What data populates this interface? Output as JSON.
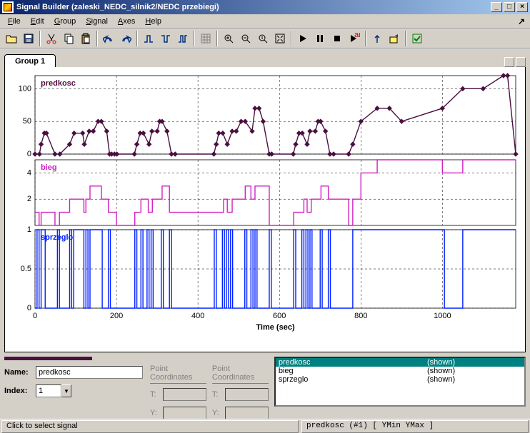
{
  "window": {
    "title": "Signal Builder (zaleski_NEDC_silnik2/NEDC przebiegi)"
  },
  "menu": {
    "file": "File",
    "edit": "Edit",
    "group": "Group",
    "signal": "Signal",
    "axes": "Axes",
    "help": "Help"
  },
  "tabs": {
    "group1": "Group 1"
  },
  "fields": {
    "name_label": "Name:",
    "name_value": "predkosc",
    "index_label": "Index:",
    "index_value": "1",
    "pc_header1": "Point Coordinates",
    "pc_header2": "Point Coordinates",
    "t_label": "T:",
    "y_label": "Y:"
  },
  "signals": {
    "header_name": "predkosc",
    "header_state": "(shown)",
    "rows": [
      {
        "name": "bieg",
        "state": "(shown)"
      },
      {
        "name": "sprzeglo",
        "state": "(shown)"
      }
    ],
    "colors": [
      "#4b0f3f",
      "#d020c0",
      "#0020ff"
    ]
  },
  "status": {
    "left": "Click to select signal",
    "right": "predkosc (#1)   [ YMin YMax ]"
  },
  "chart_data": [
    {
      "type": "line",
      "title": "predkosc",
      "xlabel": "Time (sec)",
      "xlim": [
        0,
        1180
      ],
      "ylim": [
        0,
        120
      ],
      "yticks": [
        0,
        50,
        100
      ],
      "color": "#4b0f3f",
      "markers": true,
      "x": [
        0,
        11,
        15,
        23,
        28,
        49,
        61,
        85,
        96,
        117,
        121,
        133,
        143,
        155,
        163,
        176,
        183,
        188,
        195,
        201,
        244,
        250,
        258,
        266,
        280,
        287,
        300,
        306,
        312,
        324,
        335,
        344,
        439,
        445,
        451,
        461,
        472,
        484,
        494,
        506,
        516,
        533,
        540,
        550,
        560,
        575,
        581,
        634,
        640,
        648,
        656,
        668,
        675,
        688,
        695,
        701,
        713,
        724,
        733,
        770,
        780,
        800,
        840,
        870,
        900,
        1000,
        1050,
        1100,
        1150,
        1160,
        1180
      ],
      "y": [
        0,
        0,
        15,
        32,
        32,
        0,
        0,
        15,
        32,
        32,
        15,
        35,
        35,
        50,
        50,
        35,
        0,
        0,
        0,
        0,
        0,
        15,
        32,
        32,
        15,
        35,
        35,
        50,
        50,
        35,
        0,
        0,
        0,
        15,
        32,
        32,
        15,
        35,
        35,
        50,
        50,
        35,
        70,
        70,
        50,
        0,
        0,
        0,
        15,
        32,
        32,
        15,
        35,
        35,
        50,
        50,
        35,
        0,
        0,
        0,
        15,
        50,
        70,
        70,
        50,
        70,
        100,
        100,
        120,
        120,
        0
      ]
    },
    {
      "type": "line",
      "title": "bieg",
      "xlim": [
        0,
        1180
      ],
      "ylim": [
        0,
        5
      ],
      "yticks": [
        2,
        4
      ],
      "color": "#d020c0",
      "step": true,
      "x": [
        0,
        10,
        15,
        28,
        49,
        60,
        85,
        120,
        125,
        135,
        163,
        180,
        200,
        245,
        260,
        278,
        288,
        312,
        330,
        440,
        463,
        472,
        484,
        516,
        530,
        540,
        575,
        635,
        660,
        668,
        678,
        702,
        720,
        770,
        780,
        800,
        840,
        1000,
        1050,
        1180
      ],
      "y": [
        1,
        0,
        1,
        1,
        0,
        1,
        2,
        1,
        2,
        3,
        2,
        1,
        0,
        1,
        2,
        1,
        2,
        3,
        1,
        1,
        2,
        1,
        2,
        3,
        2,
        3,
        0,
        1,
        2,
        1,
        2,
        3,
        2,
        0,
        2,
        4,
        5,
        4,
        5,
        5
      ]
    },
    {
      "type": "line",
      "title": "sprzeglo",
      "xlim": [
        0,
        1180
      ],
      "ylim": [
        0,
        1
      ],
      "yticks": [
        0,
        0.5,
        1
      ],
      "color": "#0020ff",
      "step": true,
      "x_axis_label": "Time (sec)",
      "x_ticks": [
        0,
        200,
        400,
        600,
        800,
        1000
      ],
      "x": [
        0,
        5,
        10,
        15,
        20,
        25,
        50,
        55,
        60,
        80,
        85,
        90,
        95,
        115,
        120,
        125,
        130,
        135,
        160,
        165,
        180,
        185,
        200,
        245,
        250,
        260,
        265,
        275,
        280,
        285,
        290,
        310,
        315,
        330,
        335,
        440,
        445,
        460,
        465,
        470,
        475,
        480,
        485,
        515,
        520,
        530,
        535,
        540,
        545,
        575,
        580,
        635,
        640,
        655,
        660,
        665,
        670,
        675,
        680,
        700,
        705,
        720,
        725,
        770,
        780,
        795,
        800,
        835,
        840,
        1000,
        1005,
        1050,
        1055,
        1180
      ],
      "y": [
        0,
        1,
        0,
        1,
        1,
        0,
        0,
        1,
        0,
        0,
        1,
        0,
        1,
        1,
        0,
        1,
        0,
        1,
        1,
        0,
        1,
        0,
        0,
        1,
        0,
        1,
        0,
        1,
        0,
        1,
        0,
        1,
        0,
        1,
        0,
        1,
        0,
        1,
        0,
        1,
        0,
        1,
        0,
        1,
        0,
        1,
        0,
        1,
        0,
        1,
        0,
        1,
        0,
        1,
        0,
        1,
        0,
        1,
        0,
        1,
        0,
        1,
        0,
        0,
        1,
        1,
        1,
        1,
        1,
        1,
        0,
        1,
        1,
        1
      ]
    }
  ]
}
